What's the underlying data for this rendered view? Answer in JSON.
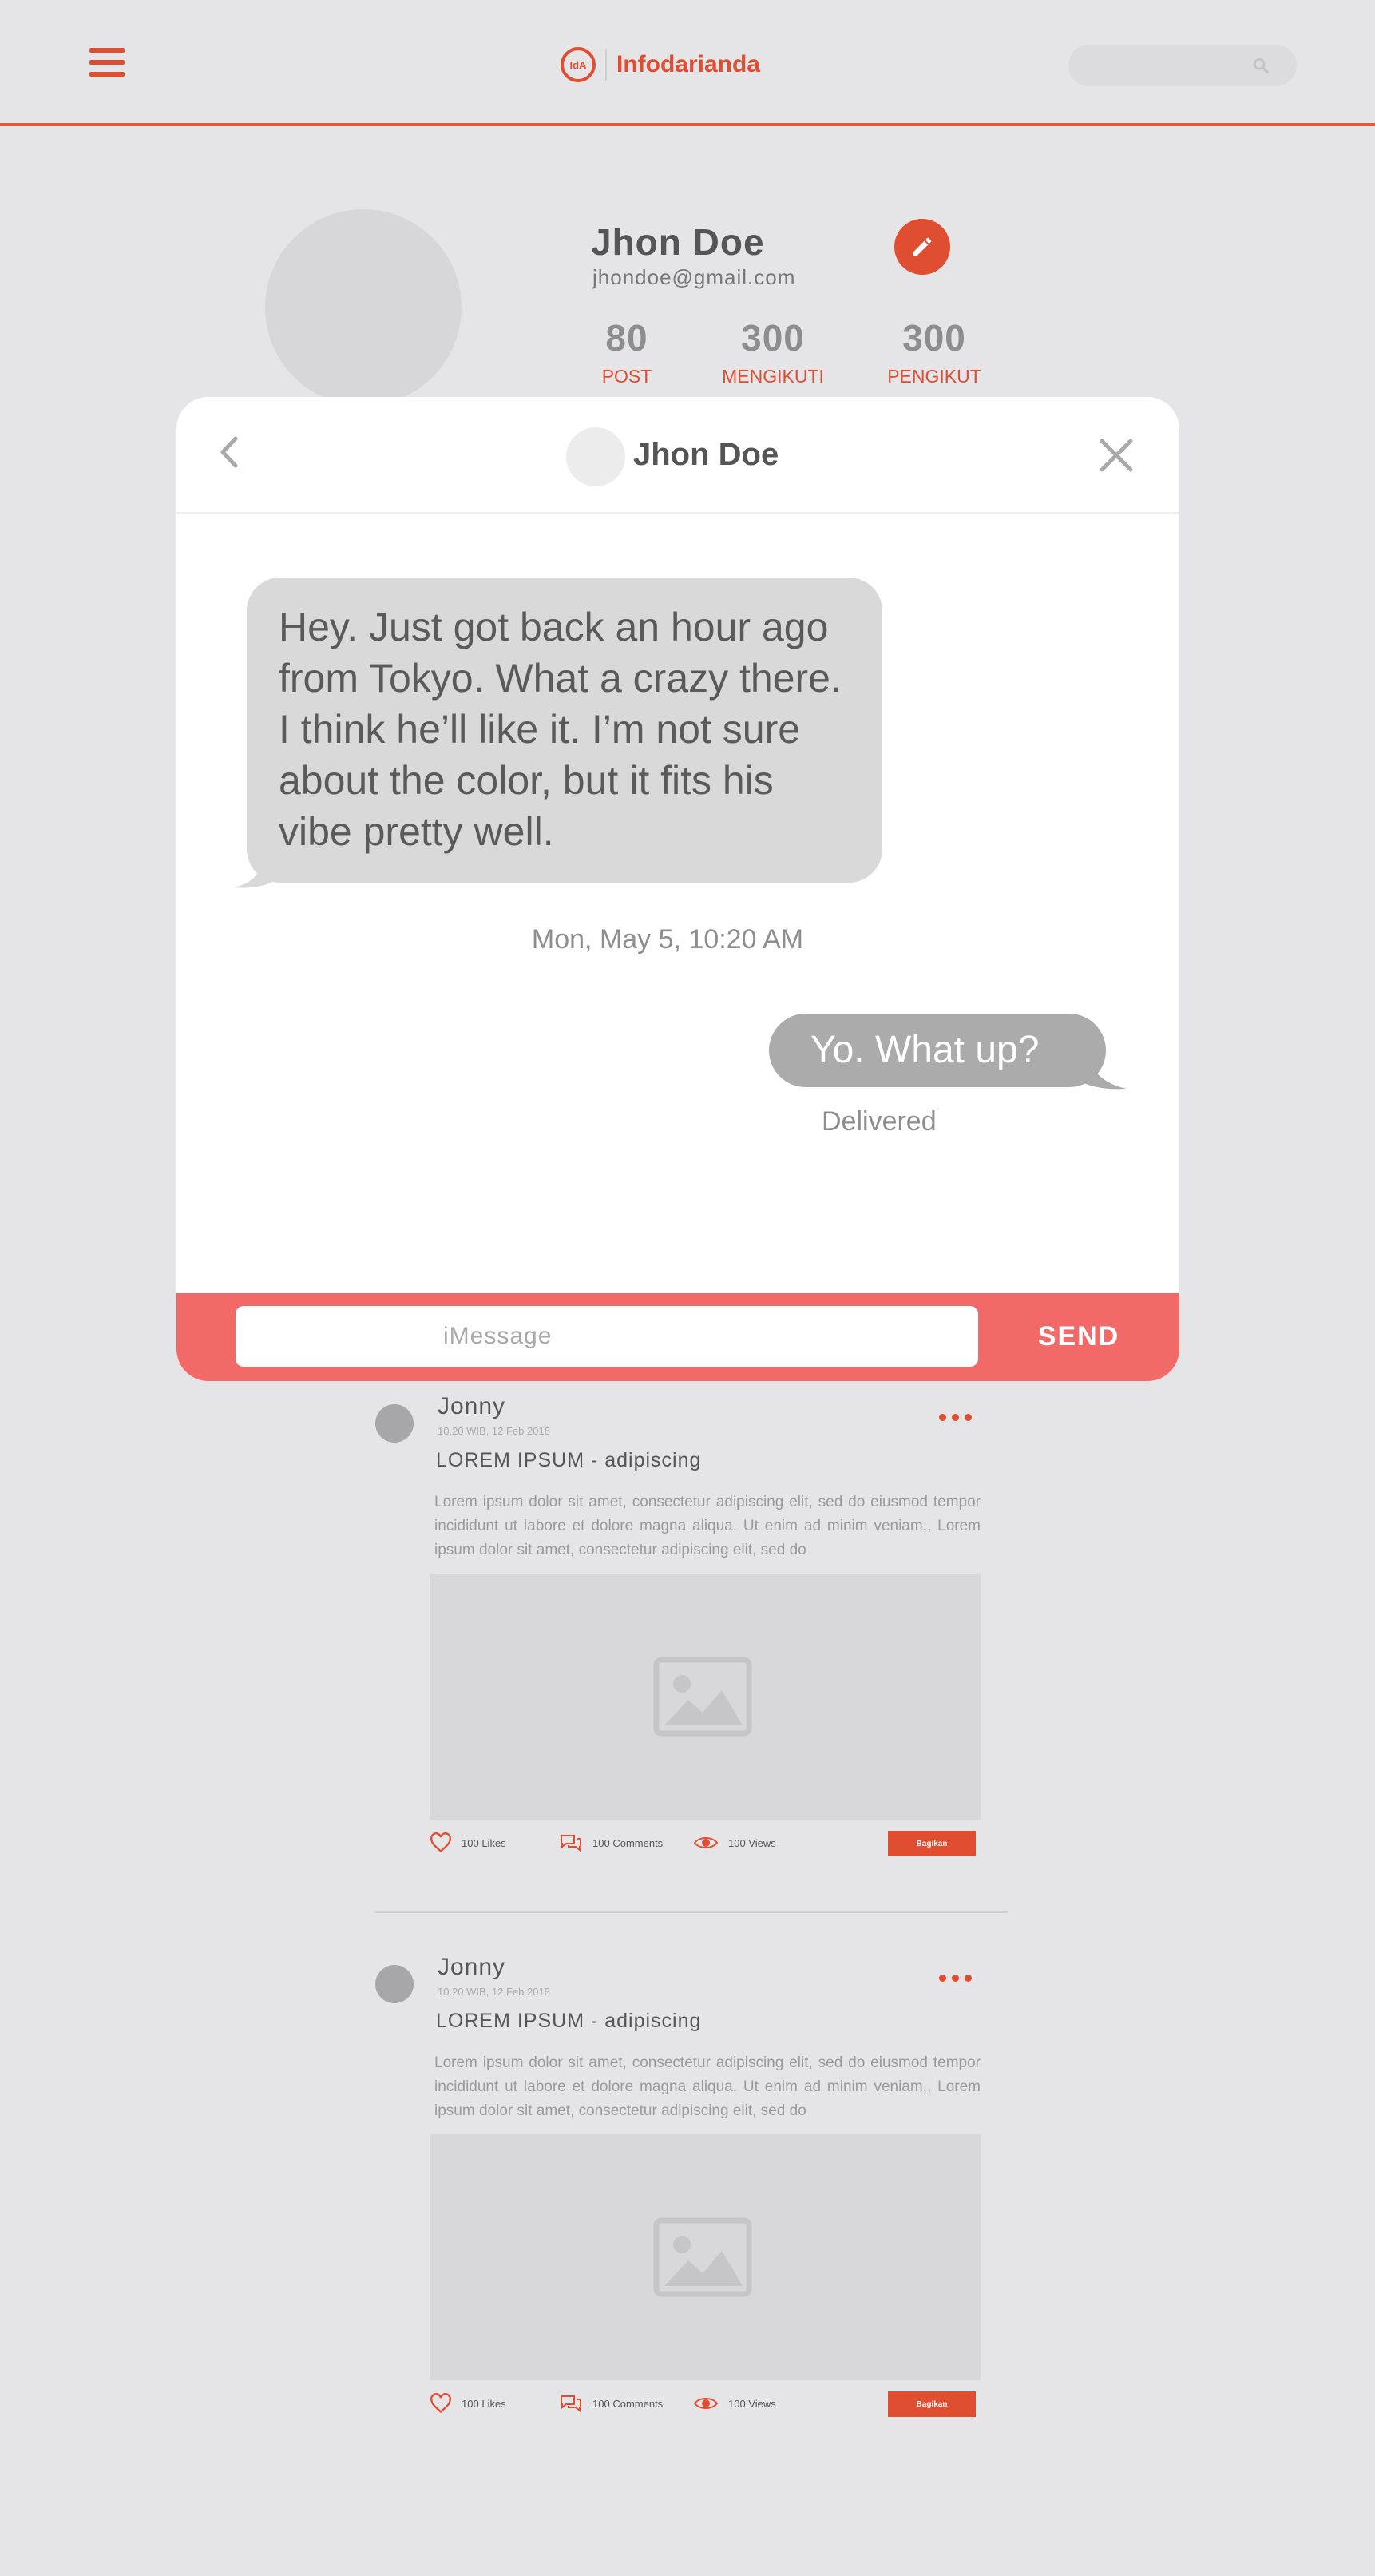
{
  "header": {
    "brand_logo_text": "IdA",
    "brand_name": "Infodarianda",
    "menu_icon": "hamburger-icon",
    "search_icon": "search-icon",
    "accent_color": "#e04e32"
  },
  "profile": {
    "name": "Jhon Doe",
    "email": "jhondoe@gmail.com",
    "edit_icon": "pencil-icon",
    "stats": [
      {
        "value": "80",
        "label": "POST"
      },
      {
        "value": "300",
        "label": "MENGIKUTI"
      },
      {
        "value": "300",
        "label": "PENGIKUT"
      }
    ]
  },
  "chat": {
    "contact_name": "Jhon Doe",
    "back_icon": "chevron-left-icon",
    "close_icon": "close-icon",
    "incoming_message": "Hey. Just got back an hour ago from Tokyo. What a crazy there. I think he’ll like it. I’m not sure about the color, but it fits his vibe pretty well.",
    "timestamp": "Mon, May 5, 10:20 AM",
    "outgoing_message": "Yo. What up?",
    "delivery_status": "Delivered",
    "input_placeholder": "iMessage",
    "send_label": "SEND",
    "composer_color": "#f26a68"
  },
  "posts": [
    {
      "author": "Jonny",
      "date": "10.20 WIB, 12 Feb 2018",
      "title": "LOREM IPSUM - adipiscing",
      "body": "Lorem ipsum dolor sit amet, consectetur adipiscing elit, sed do eiusmod tempor incididunt ut labore et dolore magna aliqua. Ut enim ad minim veniam,, Lorem ipsum dolor sit amet, consectetur adipiscing elit, sed do",
      "likes": "100",
      "likes_label": "Likes",
      "comments": "100",
      "comments_label": "Comments",
      "views": "100",
      "views_label": "Views",
      "share_label": "Bagikan"
    },
    {
      "author": "Jonny",
      "date": "10.20 WIB, 12 Feb 2018",
      "title": "LOREM IPSUM - adipiscing",
      "body": "Lorem ipsum dolor sit amet, consectetur adipiscing elit, sed do eiusmod tempor incididunt ut labore et dolore magna aliqua. Ut enim ad minim veniam,, Lorem ipsum dolor sit amet, consectetur adipiscing elit, sed do",
      "likes": "100",
      "likes_label": "Likes",
      "comments": "100",
      "comments_label": "Comments",
      "views": "100",
      "views_label": "Views",
      "share_label": "Bagikan"
    }
  ]
}
